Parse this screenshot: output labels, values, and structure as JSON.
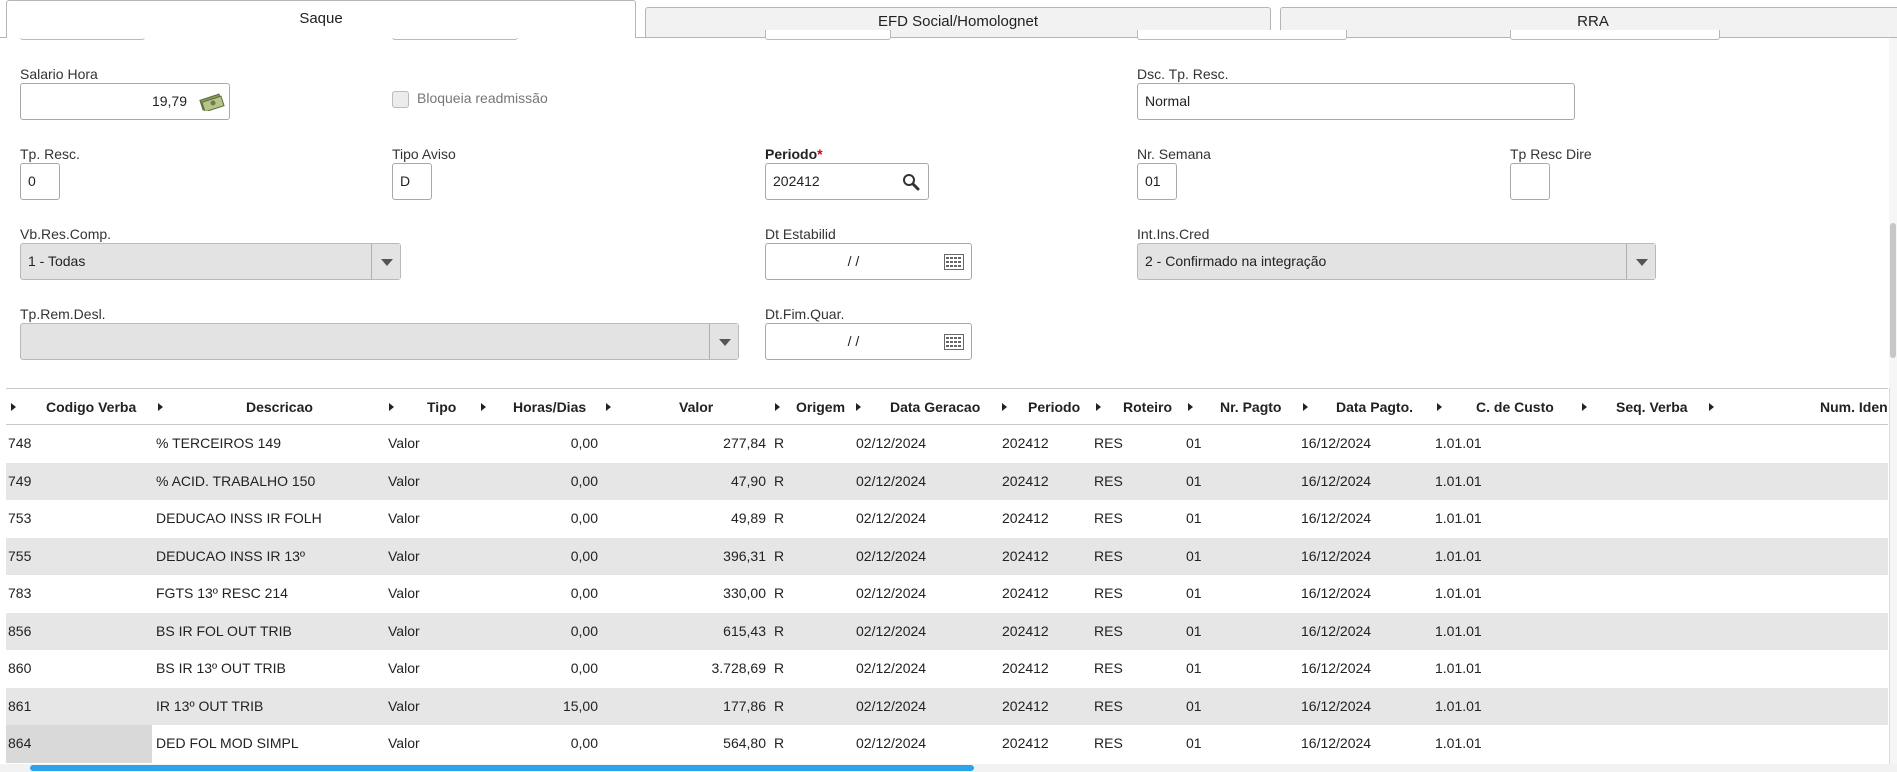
{
  "tabs": [
    {
      "label": "Saque",
      "active": true
    },
    {
      "label": "EFD Social/Homolognet",
      "active": false
    },
    {
      "label": "RRA",
      "active": false
    }
  ],
  "form": {
    "salario_hora": {
      "label": "Salario Hora",
      "value": "19,79"
    },
    "bloqueia_readmissao": {
      "label": "Bloqueia readmissão",
      "checked": false
    },
    "dsc_tp_resc": {
      "label": "Dsc. Tp. Resc.",
      "value": "Normal"
    },
    "tp_resc": {
      "label": "Tp. Resc.",
      "value": "0"
    },
    "tipo_aviso": {
      "label": "Tipo Aviso",
      "value": "D"
    },
    "periodo": {
      "label": "Periodo",
      "required_mark": "*",
      "value": "202412"
    },
    "nr_semana": {
      "label": "Nr. Semana",
      "value": "01"
    },
    "tp_resc_dire": {
      "label": "Tp Resc Dire",
      "value": ""
    },
    "vb_res_comp": {
      "label": "Vb.Res.Comp.",
      "value": "1 - Todas"
    },
    "dt_estabilid": {
      "label": "Dt Estabilid",
      "value": "/ /"
    },
    "int_ins_cred": {
      "label": "Int.Ins.Cred",
      "value": "2 - Confirmado na integração"
    },
    "tp_rem_desl": {
      "label": "Tp.Rem.Desl.",
      "value": ""
    },
    "dt_fim_quar": {
      "label": "Dt.Fim.Quar.",
      "value": "/ /"
    }
  },
  "grid": {
    "columns": [
      "Codigo Verba",
      "Descricao",
      "Tipo",
      "Horas/Dias",
      "Valor",
      "Origem",
      "Data Geracao",
      "Periodo",
      "Roteiro",
      "Nr. Pagto",
      "Data Pagto.",
      "C. de Custo",
      "Seq. Verba",
      "Num. Iden"
    ],
    "rows": [
      [
        "748",
        "% TERCEIROS 149",
        "Valor",
        "0,00",
        "277,84",
        "R",
        "02/12/2024",
        "202412",
        "RES",
        "01",
        "16/12/2024",
        "1.01.01"
      ],
      [
        "749",
        "% ACID. TRABALHO 150",
        "Valor",
        "0,00",
        "47,90",
        "R",
        "02/12/2024",
        "202412",
        "RES",
        "01",
        "16/12/2024",
        "1.01.01"
      ],
      [
        "753",
        "DEDUCAO INSS IR FOLH",
        "Valor",
        "0,00",
        "49,89",
        "R",
        "02/12/2024",
        "202412",
        "RES",
        "01",
        "16/12/2024",
        "1.01.01"
      ],
      [
        "755",
        "DEDUCAO INSS IR 13º",
        "Valor",
        "0,00",
        "396,31",
        "R",
        "02/12/2024",
        "202412",
        "RES",
        "01",
        "16/12/2024",
        "1.01.01"
      ],
      [
        "783",
        "FGTS 13º RESC 214",
        "Valor",
        "0,00",
        "330,00",
        "R",
        "02/12/2024",
        "202412",
        "RES",
        "01",
        "16/12/2024",
        "1.01.01"
      ],
      [
        "856",
        "BS IR FOL OUT TRIB",
        "Valor",
        "0,00",
        "615,43",
        "R",
        "02/12/2024",
        "202412",
        "RES",
        "01",
        "16/12/2024",
        "1.01.01"
      ],
      [
        "860",
        "BS IR 13º OUT TRIB",
        "Valor",
        "0,00",
        "3.728,69",
        "R",
        "02/12/2024",
        "202412",
        "RES",
        "01",
        "16/12/2024",
        "1.01.01"
      ],
      [
        "861",
        "IR 13º OUT TRIB",
        "Valor",
        "15,00",
        "177,86",
        "R",
        "02/12/2024",
        "202412",
        "RES",
        "01",
        "16/12/2024",
        "1.01.01"
      ],
      [
        "864",
        "DED FOL MOD SIMPL",
        "Valor",
        "0,00",
        "564,80",
        "R",
        "02/12/2024",
        "202412",
        "RES",
        "01",
        "16/12/2024",
        "1.01.01"
      ]
    ]
  },
  "colors": {
    "accent": "#2aa5ec",
    "required": "#d40000",
    "row_alt": "#e6e6e6"
  }
}
